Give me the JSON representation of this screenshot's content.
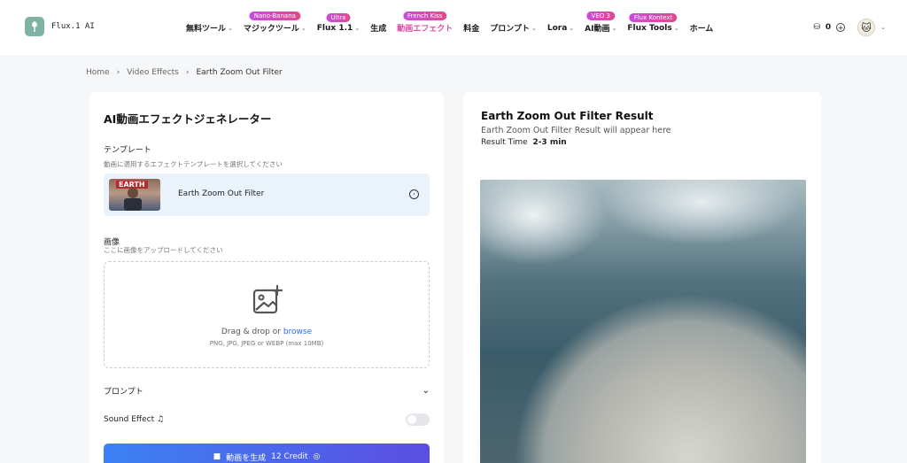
{
  "header": {
    "logo_text": "Flux.1 AI",
    "nav": [
      {
        "label": "無料ツール",
        "chevron": true,
        "badge": "",
        "active": false
      },
      {
        "label": "マジックツール",
        "chevron": true,
        "badge": "Nano-Banana",
        "active": false
      },
      {
        "label": "Flux 1.1",
        "chevron": true,
        "badge": "Ultra",
        "active": false
      },
      {
        "label": "生成",
        "chevron": false,
        "badge": "",
        "active": false
      },
      {
        "label": "動画エフェクト",
        "chevron": false,
        "badge": "French Kiss",
        "active": true
      },
      {
        "label": "料金",
        "chevron": false,
        "badge": "",
        "active": false
      },
      {
        "label": "プロンプト",
        "chevron": true,
        "badge": "",
        "active": false
      },
      {
        "label": "Lora",
        "chevron": true,
        "badge": "",
        "active": false
      },
      {
        "label": "AI動画",
        "chevron": true,
        "badge": "VEO 3",
        "active": false
      },
      {
        "label": "Flux Tools",
        "chevron": true,
        "badge": "Flux Kontext",
        "active": false
      },
      {
        "label": "ホーム",
        "chevron": false,
        "badge": "",
        "active": false
      }
    ],
    "credits": "0"
  },
  "breadcrumb": {
    "home": "Home",
    "section": "Video Effects",
    "current": "Earth Zoom Out Filter"
  },
  "left": {
    "title": "AI動画エフェクトジェネレーター",
    "template_label": "テンプレート",
    "template_hint": "動画に適用するエフェクトテンプレートを選択してください",
    "template_name": "Earth Zoom Out Filter",
    "image_label": "画像",
    "image_hint": "ここに画像をアップロードしてください",
    "drop_text": "Drag & drop or ",
    "browse": "browse",
    "formats": "PNG, JPG, JPEG or WEBP (max 10MB)",
    "prompt_label": "プロンプト",
    "sound_label": "Sound Effect",
    "sound_on": false,
    "generate_label": "動画を生成",
    "credit_label": "12 Credit"
  },
  "right": {
    "title": "Earth Zoom Out Filter Result",
    "subtitle": "Earth Zoom Out Filter Result will appear here",
    "time_label": "Result Time",
    "time_value": "2-3 min"
  },
  "colors": {
    "accent": "#e04aa3",
    "link": "#2b6ee5",
    "button_start": "#3b82f6",
    "button_end": "#5b4ee0"
  }
}
